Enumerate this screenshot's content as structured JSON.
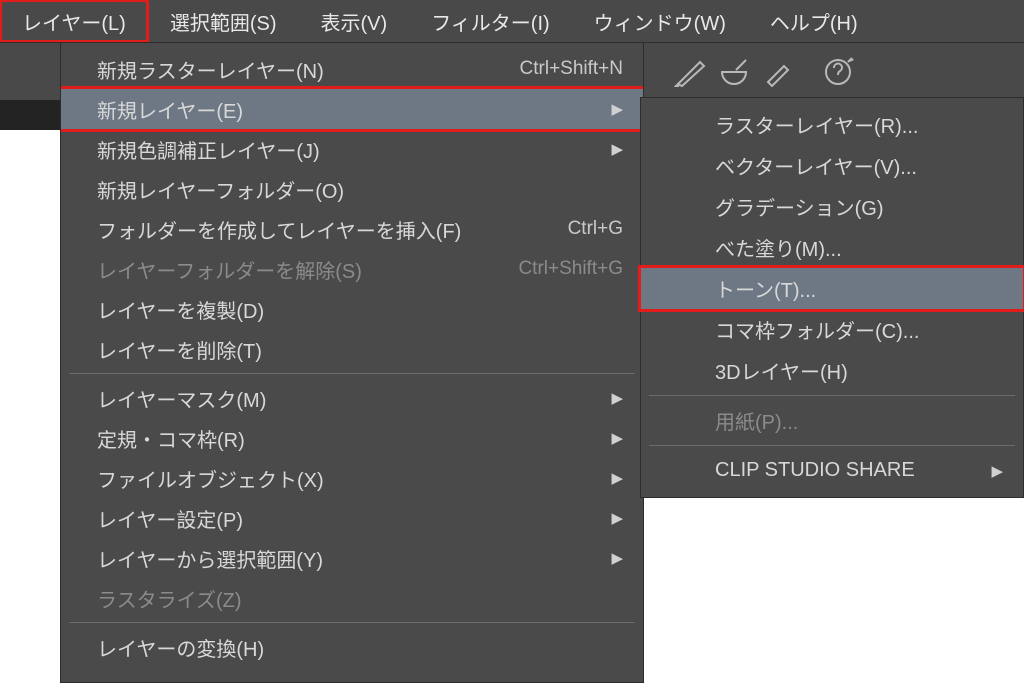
{
  "menubar": [
    {
      "label": "レイヤー(L)",
      "highlight": true
    },
    {
      "label": "選択範囲(S)"
    },
    {
      "label": "表示(V)"
    },
    {
      "label": "フィルター(I)"
    },
    {
      "label": "ウィンドウ(W)"
    },
    {
      "label": "ヘルプ(H)"
    }
  ],
  "toolbar_icons": [
    "brush-icon",
    "mortar-icon",
    "brush2-icon",
    "help-icon"
  ],
  "dropdown": [
    {
      "label": "新規ラスターレイヤー(N)",
      "shortcut": "Ctrl+Shift+N"
    },
    {
      "label": "新規レイヤー(E)",
      "arrow": true,
      "hover": true,
      "redbox": true
    },
    {
      "label": "新規色調補正レイヤー(J)",
      "arrow": true
    },
    {
      "label": "新規レイヤーフォルダー(O)"
    },
    {
      "label": "フォルダーを作成してレイヤーを挿入(F)",
      "shortcut": "Ctrl+G"
    },
    {
      "label": "レイヤーフォルダーを解除(S)",
      "shortcut": "Ctrl+Shift+G",
      "disabled": true
    },
    {
      "label": "レイヤーを複製(D)"
    },
    {
      "label": "レイヤーを削除(T)"
    },
    {
      "sep": true
    },
    {
      "label": "レイヤーマスク(M)",
      "arrow": true
    },
    {
      "label": "定規・コマ枠(R)",
      "arrow": true
    },
    {
      "label": "ファイルオブジェクト(X)",
      "arrow": true
    },
    {
      "label": "レイヤー設定(P)",
      "arrow": true
    },
    {
      "label": "レイヤーから選択範囲(Y)",
      "arrow": true
    },
    {
      "label": "ラスタライズ(Z)",
      "disabled": true
    },
    {
      "sep": true
    },
    {
      "label": "レイヤーの変換(H)"
    }
  ],
  "submenu": [
    {
      "label": "ラスターレイヤー(R)..."
    },
    {
      "label": "ベクターレイヤー(V)..."
    },
    {
      "label": "グラデーション(G)"
    },
    {
      "label": "べた塗り(M)..."
    },
    {
      "label": "トーン(T)...",
      "hover": true,
      "redbox": true
    },
    {
      "label": "コマ枠フォルダー(C)..."
    },
    {
      "label": "3Dレイヤー(H)"
    },
    {
      "sep": true
    },
    {
      "label": "用紙(P)...",
      "disabled": true
    },
    {
      "sep": true
    },
    {
      "label": "CLIP STUDIO SHARE",
      "arrow": true
    }
  ]
}
